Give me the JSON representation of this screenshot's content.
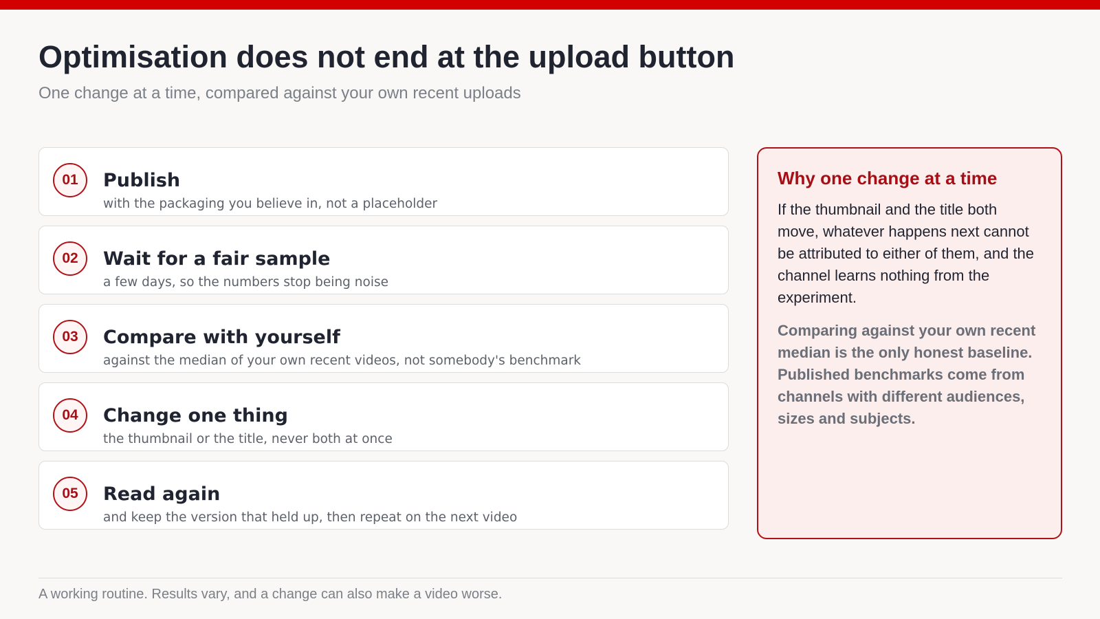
{
  "colors": {
    "accent": "#d30000",
    "accent_dark": "#a50f15",
    "panel_bg": "#fdeeee",
    "page_bg": "#f9f8f6"
  },
  "header": {
    "title": "Optimisation does not end at the upload button",
    "subtitle": "One change at a time, compared against your own recent uploads"
  },
  "steps": [
    {
      "number": "01",
      "title": "Publish",
      "description": "with the packaging you believe in, not a placeholder"
    },
    {
      "number": "02",
      "title": "Wait for a fair sample",
      "description": "a few days, so the numbers stop being noise"
    },
    {
      "number": "03",
      "title": "Compare with yourself",
      "description": "against the median of your own recent videos, not somebody's benchmark"
    },
    {
      "number": "04",
      "title": "Change one thing",
      "description": "the thumbnail or the title, never both at once"
    },
    {
      "number": "05",
      "title": "Read again",
      "description": "and keep the version that held up, then repeat on the next video"
    }
  ],
  "aside": {
    "title": "Why one change at a time",
    "body": "If the thumbnail and the title both move, whatever happens next cannot be attributed to either of them, and the channel learns nothing from the experiment.",
    "note": "Comparing against your own recent median is the only honest baseline. Published benchmarks come from channels with different audiences, sizes and subjects."
  },
  "footer": {
    "text": "A working routine. Results vary, and a change can also make a video worse."
  }
}
